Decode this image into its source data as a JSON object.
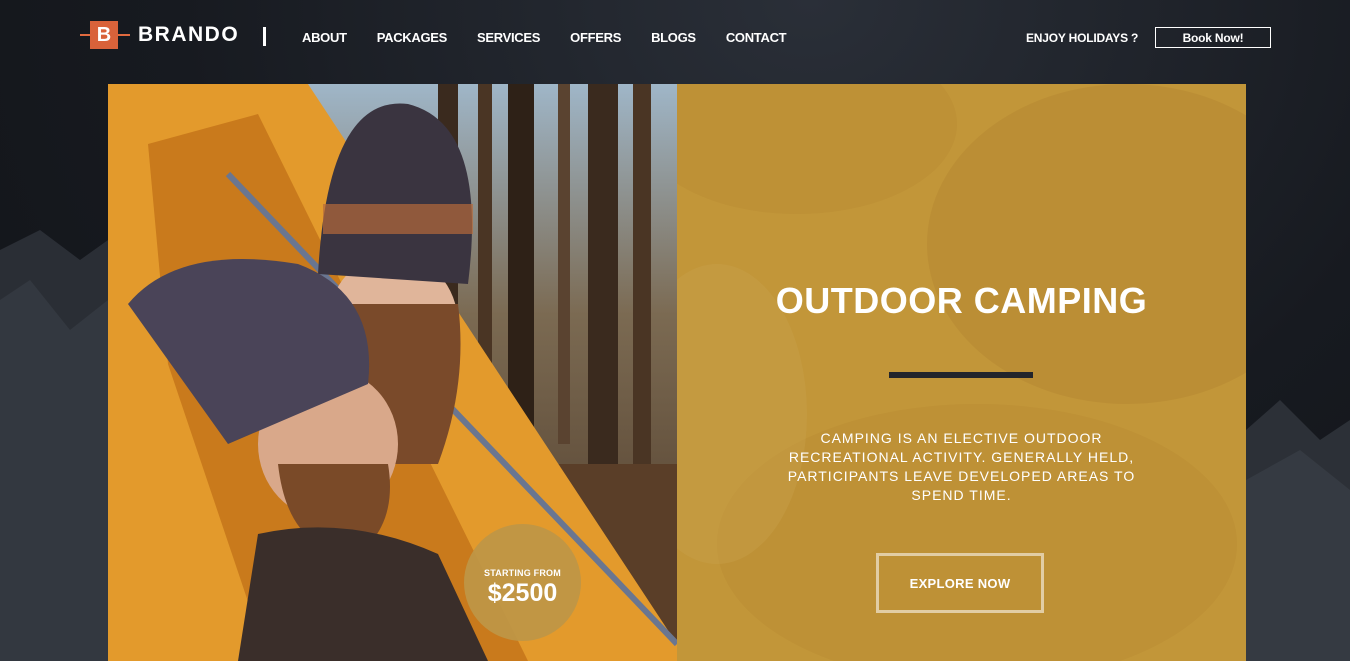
{
  "header": {
    "logo_letter": "B",
    "brand": "BRANDO",
    "nav": [
      "ABOUT",
      "PACKAGES",
      "SERVICES",
      "OFFERS",
      "BLOGS",
      "CONTACT"
    ],
    "tagline": "ENJOY HOLIDAYS ?",
    "cta_label": "Book Now!"
  },
  "hero": {
    "price_label": "STARTING FROM",
    "price_value": "$2500",
    "title": "OUTDOOR CAMPING",
    "description": "CAMPING IS AN ELECTIVE OUTDOOR RECREATIONAL ACTIVITY. GENERALLY HELD, PARTICIPANTS LEAVE DEVELOPED AREAS TO SPEND TIME.",
    "cta_label": "EXPLORE NOW"
  },
  "colors": {
    "accent_orange": "#d9623a",
    "panel_gold": "#c29639",
    "tent_orange": "#e39a2c",
    "background_dark": "#171a20"
  }
}
